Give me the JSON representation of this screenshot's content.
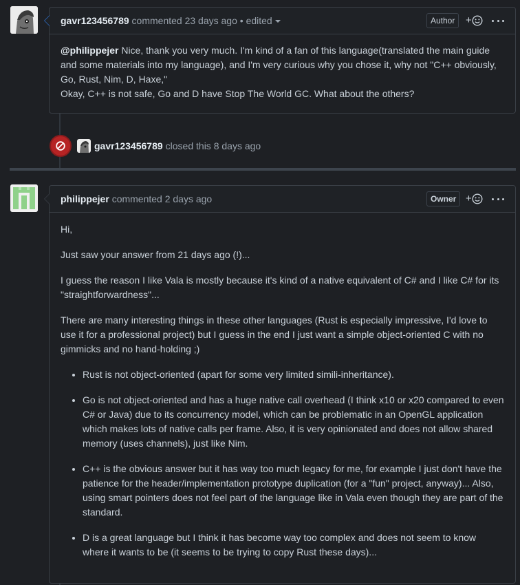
{
  "comments": [
    {
      "author": "gavr123456789",
      "action": "commented 23 days ago",
      "separator": "•",
      "edited_label": "edited",
      "role_badge": "Author",
      "body": {
        "mention": "@philippejer",
        "text": " Nice, thank you very much. I'm kind of a fan of this language(translated the main guide and some materials into my language), and I'm very curious why you chose it, why not \"C++ obviously, Go, Rust, Nim, D, Haxe,\"",
        "line2": "Okay, C++ is not safe, Go and D have Stop The World GC. What about the others?"
      }
    },
    {
      "author": "philippejer",
      "action": "commented 2 days ago",
      "role_badge": "Owner",
      "paragraphs": [
        "Hi,",
        "Just saw your answer from 21 days ago (!)...",
        "I guess the reason I like Vala is mostly because it's kind of a native equivalent of C# and I like C# for its \"straightforwardness\"...",
        "There are many interesting things in these other languages (Rust is especially impressive, I'd love to use it for a professional project) but I guess in the end I just want a simple object-oriented C with no gimmicks and no hand-holding ;)"
      ],
      "bullets": [
        "Rust is not object-oriented (apart for some very limited simili-inheritance).",
        "Go is not object-oriented and has a huge native call overhead (I think x10 or x20 compared to even C# or Java) due to its concurrency model, which can be problematic in an OpenGL application which makes lots of native calls per frame. Also, it is very opinionated and does not allow shared memory (uses channels), just like Nim.",
        "C++ is the obvious answer but it has way too much legacy for me, for example I just don't have the patience for the header/implementation prototype duplication (for a \"fun\" project, anyway)... Also, using smart pointers does not feel part of the language like in Vala even though they are part of the standard.",
        "D is a great language but I think it has become way too complex and does not seem to know where it wants to be (it seems to be trying to copy Rust these days)..."
      ]
    }
  ],
  "closed_event": {
    "author": "gavr123456789",
    "text": "closed this 8 days ago"
  },
  "reaction_label": "+",
  "icons": {
    "closed": "circle-slash-icon",
    "reaction": "smiley-icon",
    "more": "kebab-horizontal-icon"
  },
  "colors": {
    "background": "#1e2024",
    "closed_badge": "#b62324",
    "border": "#3a3f46",
    "highlight_caret": "#2f6fc9"
  }
}
